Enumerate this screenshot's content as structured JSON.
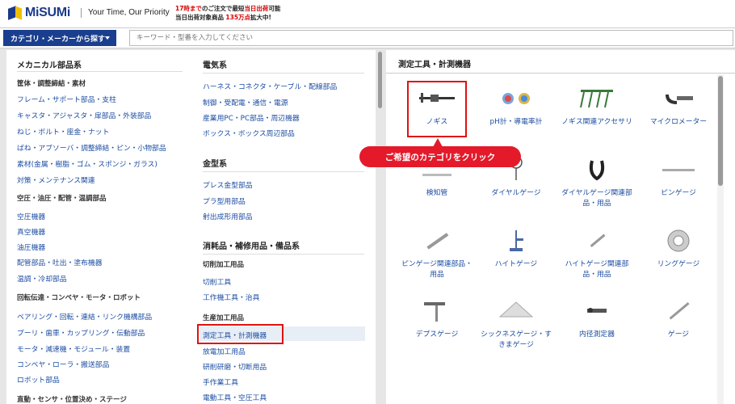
{
  "header": {
    "logo_text": "MiSUMi",
    "tagline": "Your Time, Our Priority",
    "promo_line1_red": "17時まで",
    "promo_line1_mid": "のご注文で最短",
    "promo_line1_red2": "当日出荷",
    "promo_line1_end": "可能",
    "promo_line2_start": "当日出荷対象商品",
    "promo_line2_red": "135万点",
    "promo_line2_end": "拡大中!"
  },
  "search": {
    "category_button": "カテゴリ・メーカーから探す",
    "placeholder": "キーワード・型番を入力してください"
  },
  "col1": {
    "title": "メカニカル部品系",
    "groups": [
      {
        "heading": "筐体・調整締結・素材",
        "links": [
          "フレーム・サポート部品・支柱",
          "キャスタ・アジャスタ・扉部品・外装部品",
          "ねじ・ボルト・座金・ナット",
          "ばね・アブソーバ・調整締結・ピン・小物部品",
          "素材(金属・樹脂・ゴム・スポンジ・ガラス)",
          "対策・メンテナンス関連"
        ]
      },
      {
        "heading": "空圧・油圧・配管・温調部品",
        "links": [
          "空圧機器",
          "真空機器",
          "油圧機器",
          "配管部品・吐出・塗布機器",
          "温調・冷却部品"
        ]
      },
      {
        "heading": "回転伝達・コンベヤ・モータ・ロボット",
        "links": [
          "ベアリング・回転・連結・リンク機構部品",
          "プーリ・歯車・カップリング・伝動部品",
          "モータ・減速機・モジュール・装置",
          "コンベヤ・ローラ・搬送部品",
          "ロボット部品"
        ]
      },
      {
        "heading": "直動・センサ・位置決め・ステージ",
        "links": []
      }
    ]
  },
  "col2": {
    "sections": [
      {
        "title": "電気系",
        "links": [
          "ハーネス・コネクタ・ケーブル・配線部品",
          "制御・受配電・通信・電源",
          "産業用PC・PC部品・周辺機器",
          "ボックス・ボックス周辺部品"
        ]
      },
      {
        "title": "金型系",
        "links": [
          "プレス金型部品",
          "プラ型用部品",
          "射出成形用部品"
        ]
      },
      {
        "title": "消耗品・補修用品・備品系",
        "groups": [
          {
            "heading": "切削加工用品",
            "links": [
              "切削工具",
              "工作機工具・治具"
            ]
          },
          {
            "heading": "生産加工用品",
            "links": [
              "測定工具・計測機器",
              "放電加工用品",
              "研削研磨・切断用品",
              "手作業工具",
              "電動工具・空圧工具"
            ]
          }
        ]
      }
    ]
  },
  "right": {
    "title": "測定工具・計測機器",
    "tiles": [
      {
        "label": "ノギス",
        "icon": "caliper-icon"
      },
      {
        "label": "pH計・導電率計",
        "icon": "ph-meter-icon"
      },
      {
        "label": "ノギス関連アクセサリ",
        "icon": "caliper-accessory-icon"
      },
      {
        "label": "マイクロメーター",
        "icon": "micrometer-icon"
      },
      {
        "label": "検知管",
        "icon": "detector-tube-icon"
      },
      {
        "label": "ダイヤルゲージ",
        "icon": "dial-gauge-icon"
      },
      {
        "label": "ダイヤルゲージ関連部品・用品",
        "icon": "dial-gauge-part-icon"
      },
      {
        "label": "ピンゲージ",
        "icon": "pin-gauge-icon"
      },
      {
        "label": "ピンゲージ関連部品・用品",
        "icon": "pin-gauge-part-icon"
      },
      {
        "label": "ハイトゲージ",
        "icon": "height-gauge-icon"
      },
      {
        "label": "ハイトゲージ関連部品・用品",
        "icon": "height-gauge-part-icon"
      },
      {
        "label": "リングゲージ",
        "icon": "ring-gauge-icon"
      },
      {
        "label": "デプスゲージ",
        "icon": "depth-gauge-icon"
      },
      {
        "label": "シックネスゲージ・すきまゲージ",
        "icon": "thickness-gauge-icon"
      },
      {
        "label": "内径測定器",
        "icon": "bore-gauge-icon"
      },
      {
        "label": "ゲージ",
        "icon": "gauge-icon"
      }
    ]
  },
  "callout": "ご希望のカテゴリをクリック"
}
